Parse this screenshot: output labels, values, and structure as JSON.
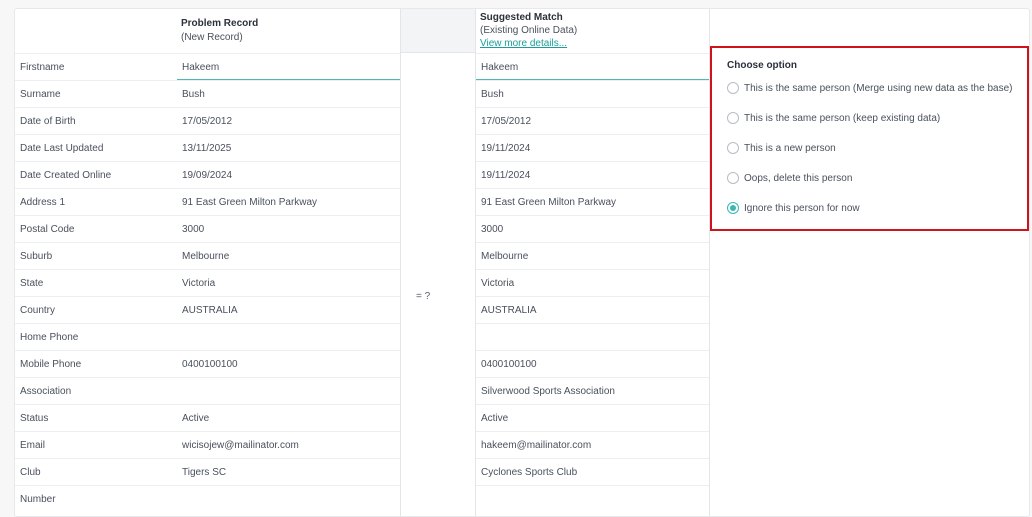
{
  "headers": {
    "problem": {
      "title": "Problem Record",
      "sub": "(New Record)"
    },
    "match": {
      "title": "Suggested Match",
      "sub": "(Existing Online Data)",
      "link": "View more details..."
    }
  },
  "compare_symbol": "= ?",
  "rows": [
    {
      "label": "Firstname",
      "problem": "Hakeem",
      "match": "Hakeem"
    },
    {
      "label": "Surname",
      "problem": "Bush",
      "match": "Bush"
    },
    {
      "label": "Date of Birth",
      "problem": "17/05/2012",
      "match": "17/05/2012"
    },
    {
      "label": "Date Last Updated",
      "problem": "13/11/2025",
      "match": "19/11/2024"
    },
    {
      "label": "Date Created Online",
      "problem": "19/09/2024",
      "match": "19/11/2024"
    },
    {
      "label": "Address 1",
      "problem": "91 East Green Milton Parkway",
      "match": "91 East Green Milton Parkway"
    },
    {
      "label": "Postal Code",
      "problem": "3000",
      "match": "3000"
    },
    {
      "label": "Suburb",
      "problem": "Melbourne",
      "match": "Melbourne"
    },
    {
      "label": "State",
      "problem": "Victoria",
      "match": "Victoria"
    },
    {
      "label": "Country",
      "problem": "AUSTRALIA",
      "match": "AUSTRALIA"
    },
    {
      "label": "Home Phone",
      "problem": "",
      "match": ""
    },
    {
      "label": "Mobile Phone",
      "problem": "0400100100",
      "match": "0400100100"
    },
    {
      "label": "Association",
      "problem": "",
      "match": "Silverwood Sports Association"
    },
    {
      "label": "Status",
      "problem": "Active",
      "match": "Active"
    },
    {
      "label": "Email",
      "problem": "wicisojew@mailinator.com",
      "match": "hakeem@mailinator.com"
    },
    {
      "label": "Club",
      "problem": "Tigers SC",
      "match": "Cyclones Sports Club"
    },
    {
      "label": "Number",
      "problem": "",
      "match": ""
    }
  ],
  "options": {
    "title": "Choose option",
    "items": [
      {
        "label": "This is the same person (Merge using new data as the base)",
        "checked": false
      },
      {
        "label": "This is the same person (keep existing data)",
        "checked": false
      },
      {
        "label": "This is a new person",
        "checked": false
      },
      {
        "label": "Oops, delete this person",
        "checked": false
      },
      {
        "label": "Ignore this person for now",
        "checked": true
      }
    ]
  },
  "colors": {
    "accent": "#3bb7b1",
    "highlight_border": "#d0121b",
    "link": "#1a9e9a"
  }
}
